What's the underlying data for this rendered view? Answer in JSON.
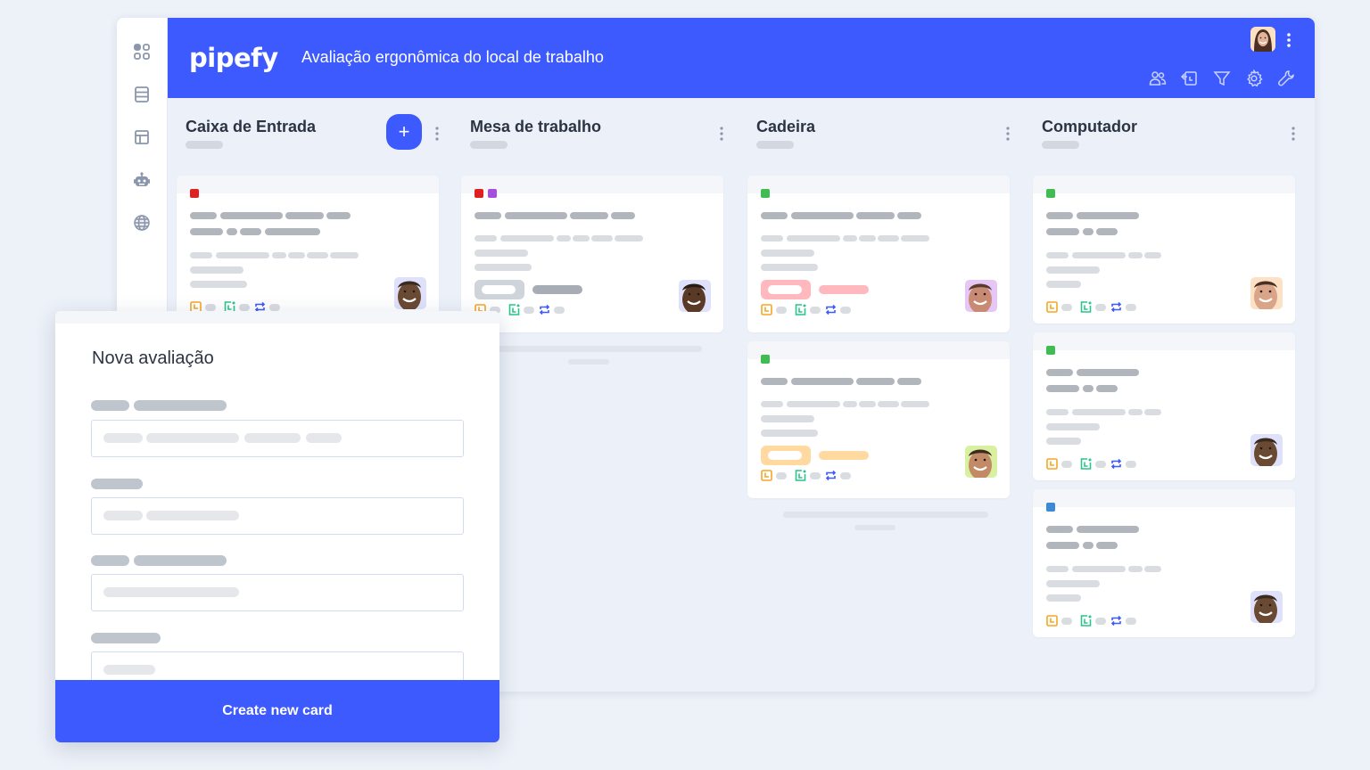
{
  "app": {
    "logo": "pipefy",
    "pipe_title": "Avaliação ergonômica do local de trabalho",
    "brand_color": "#3d5afe"
  },
  "sidebar": {
    "items": [
      {
        "icon": "apps-grid-icon"
      },
      {
        "icon": "database-icon"
      },
      {
        "icon": "layout-icon"
      },
      {
        "icon": "robot-icon"
      },
      {
        "icon": "globe-icon"
      }
    ]
  },
  "toolbar": {
    "user_avatar": "user-avatar-woman",
    "icons": [
      "members-icon",
      "import-icon",
      "filter-icon",
      "settings-gear-icon",
      "wrench-icon"
    ]
  },
  "phases": [
    {
      "title": "Caixa de Entrada",
      "has_add_button": true,
      "add_label": "+",
      "cards": [
        {
          "tags": [
            "#e02020"
          ],
          "avatar": "avatar-glasses",
          "avatar_bg": "#dfe1fb",
          "bg_tones": [
            "#6b4a33",
            "#3a2a20"
          ]
        }
      ]
    },
    {
      "title": "Mesa de trabalho",
      "has_add_button": false,
      "cards": [
        {
          "tags": [
            "#e02020",
            "#a74de0"
          ],
          "pill_color": "#cfd3da",
          "pill_bar": "#a8adb5",
          "avatar": "avatar-beard",
          "avatar_bg": "#dfe1fb",
          "bg_tones": [
            "#5a3a26",
            "#2a1c14"
          ]
        }
      ]
    },
    {
      "title": "Cadeira",
      "has_add_button": false,
      "cards": [
        {
          "tags": [
            "#3fbd52"
          ],
          "pill_color": "#ffb8bd",
          "pill_bar": "#ffb8bd",
          "avatar": "avatar-man-smile",
          "avatar_bg": "#e5c6f5",
          "bg_tones": [
            "#c98a73",
            "#5a3a2a"
          ]
        },
        {
          "tags": [
            "#3fbd52"
          ],
          "pill_color": "#ffd9a0",
          "pill_bar": "#ffd9a0",
          "avatar": "avatar-man-green",
          "avatar_bg": "#d8f0a0",
          "bg_tones": [
            "#c28a66",
            "#3a2a20"
          ]
        }
      ]
    },
    {
      "title": "Computador",
      "has_add_button": false,
      "cards": [
        {
          "tags": [
            "#3fbd52"
          ],
          "avatar": "avatar-woman",
          "avatar_bg": "#fde1c4",
          "bg_tones": [
            "#d9a487",
            "#4a3024"
          ]
        },
        {
          "tags": [
            "#3fbd52"
          ],
          "avatar": "avatar-glasses",
          "avatar_bg": "#dfe1fb",
          "bg_tones": [
            "#6b4a33",
            "#3a2a20"
          ]
        },
        {
          "tags": [
            "#3b8ad8"
          ],
          "avatar": "avatar-glasses",
          "avatar_bg": "#dfe1fb",
          "bg_tones": [
            "#6b4a33",
            "#3a2a20"
          ]
        }
      ]
    }
  ],
  "card_icons": [
    "due-date-clock-icon",
    "phase-time-icon",
    "repeat-icon"
  ],
  "modal": {
    "title": "Nova avaliação",
    "fields": 4,
    "submit_label": "Create new card"
  }
}
